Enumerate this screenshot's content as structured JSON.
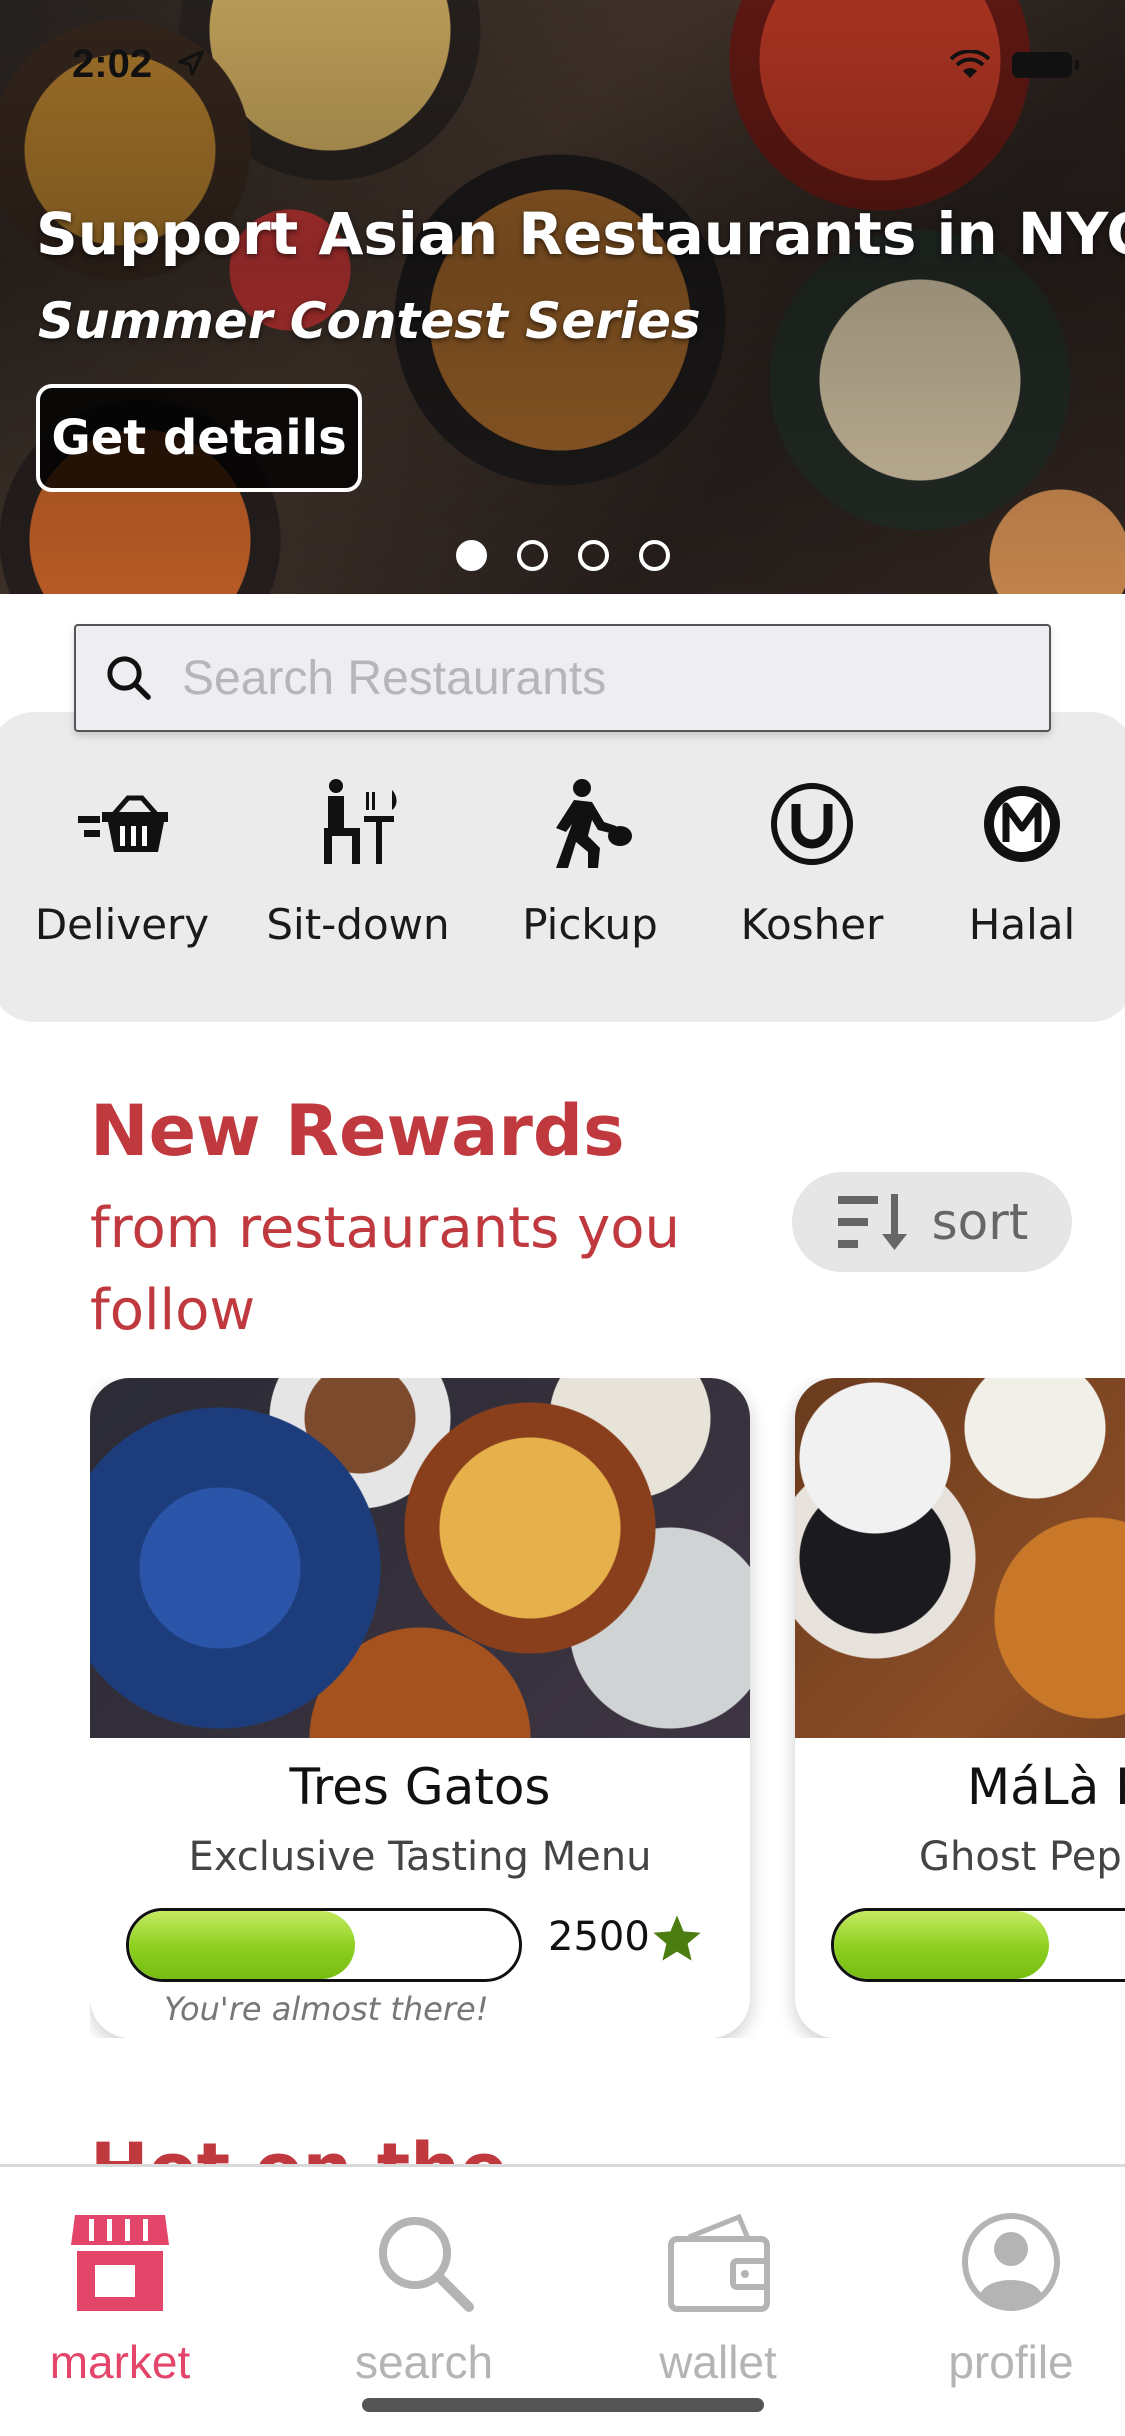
{
  "status_bar": {
    "time": "2:02"
  },
  "hero": {
    "title": "Support Asian Restaurants in NYC",
    "subtitle": "Summer Contest Series",
    "button_label": "Get details",
    "active_slide": 1,
    "slide_count": 4
  },
  "search": {
    "placeholder": "Search Restaurants",
    "value": ""
  },
  "categories": [
    {
      "label": "Delivery",
      "icon": "delivery-basket-icon"
    },
    {
      "label": "Sit-down",
      "icon": "sit-down-dining-icon"
    },
    {
      "label": "Pickup",
      "icon": "pickup-walking-icon"
    },
    {
      "label": "Kosher",
      "icon": "kosher-u-icon"
    },
    {
      "label": "Halal",
      "icon": "halal-m-icon"
    }
  ],
  "rewards": {
    "title": "New Rewards",
    "subtitle": "from restaurants you follow",
    "sort_label": "sort",
    "cards": [
      {
        "name": "Tres Gatos",
        "offer": "Exclusive Tasting Menu",
        "points": "2500",
        "progress": 0.58,
        "note": "You're almost there!"
      },
      {
        "name": "MáLà F",
        "offer": "Ghost Pepp",
        "progress": 0.55
      }
    ]
  },
  "next_section_title": "Hot on the",
  "tabbar": {
    "tabs": [
      {
        "label": "market",
        "icon": "market-storefront-icon",
        "active": true
      },
      {
        "label": "search",
        "icon": "search-magnifier-icon",
        "active": false
      },
      {
        "label": "wallet",
        "icon": "wallet-icon",
        "active": false
      },
      {
        "label": "profile",
        "icon": "profile-avatar-icon",
        "active": false
      }
    ]
  },
  "colors": {
    "accent": "#c0393e",
    "tab_active": "#e4456a",
    "progress_green": "#8ccf1f",
    "star_green": "#4b7d10"
  }
}
